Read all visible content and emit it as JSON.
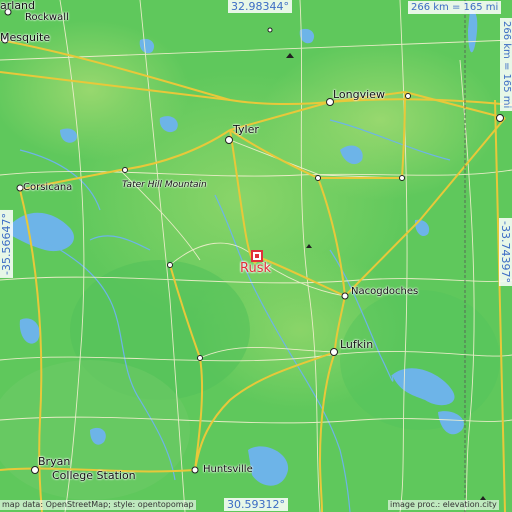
{
  "map": {
    "target_city": "Rusk",
    "lat_top": "32.98344°",
    "lat_bottom": "30.59312°",
    "lon_left": "-35.56647°",
    "lon_right": "-33.74397°",
    "scale_top": "266 km = 165 mi",
    "scale_right": "266 km = 165 mi",
    "credit_left": "map data: OpenStreetMap; style: opentopomap",
    "credit_right": "image proc.: elevation.city",
    "cities": {
      "garland": "arland",
      "rockwall": "Rockwall",
      "mesquite": "Mesquite",
      "tyler": "Tyler",
      "longview": "Longview",
      "corsicana": "Corsicana",
      "tater_hill": "Tater Hill Mountain",
      "rusk": "Rusk",
      "nacogdoches": "Nacogdoches",
      "lufkin": "Lufkin",
      "huntsville": "Huntsville",
      "bryan": "Bryan",
      "college_station": "College Station"
    }
  },
  "colors": {
    "land_low": "#5cc85a",
    "land_mid": "#6fcf5f",
    "water": "#6db4e8",
    "road_major": "#e8c83a",
    "road_minor": "#f4f0d0",
    "target": "#e0303a",
    "coord_text": "#3b6cc4"
  }
}
